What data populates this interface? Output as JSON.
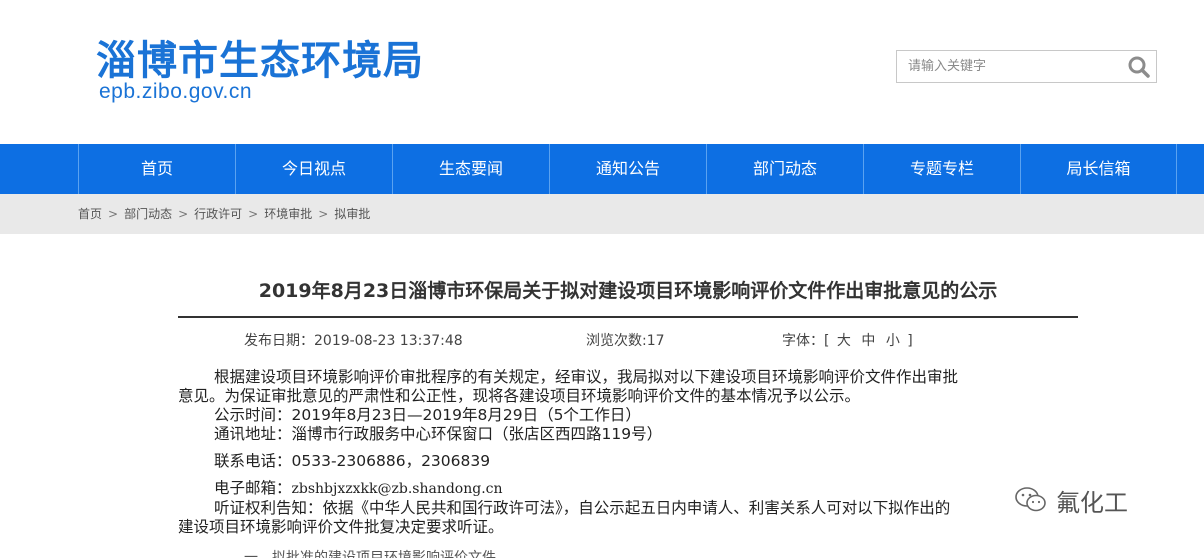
{
  "header": {
    "site_title": "淄博市生态环境局",
    "site_url": "epb.zibo.gov.cn",
    "search_placeholder": "请输入关键字"
  },
  "nav": {
    "items": [
      "首页",
      "今日视点",
      "生态要闻",
      "通知公告",
      "部门动态",
      "专题专栏",
      "局长信箱"
    ]
  },
  "breadcrumb": {
    "items": [
      "首页",
      "部门动态",
      "行政许可",
      "环境审批",
      "拟审批"
    ],
    "separator": ">"
  },
  "article": {
    "title": "2019年8月23日淄博市环保局关于拟对建设项目环境影响评价文件作出审批意见的公示",
    "meta": {
      "date_label": "发布日期：",
      "date_value": "2019-08-23 13:37:48",
      "views_label": "浏览次数:",
      "views_value": "17",
      "font_label": "字体：[",
      "font_large": "大",
      "font_medium": "中",
      "font_small": "小",
      "font_close": "]"
    },
    "intro_1": "根据建设项目环境影响评价审批程序的有关规定，经审议，我局拟对以下建设项目环境影响评价文件作出审批",
    "intro_2": "意见。为保证审批意见的严肃性和公正性，现将各建设项目环境影响评价文件的基本情况予以公示。",
    "period": "公示时间：2019年8月23日—2019年8月29日（5个工作日）",
    "address": "通讯地址：淄博市行政服务中心环保窗口（张店区西四路119号）",
    "phone": "联系电话：0533-2306886，2306839",
    "email_label": "电子邮箱：",
    "email_value": "zbshbjxzxkk@zb.shandong.cn",
    "hearing_1": "听证权利告知：依据《中华人民共和国行政许可法》，自公示起五日内申请人、利害关系人可对以下拟作出的",
    "hearing_2": "建设项目环境影响评价文件批复决定要求听证。",
    "cut_line": "一、拟批准的建设项目环境影响评价文件"
  },
  "watermark": {
    "text": "氟化工",
    "icon": "wechat-icon"
  },
  "colors": {
    "brand_blue": "#1a73d6",
    "nav_blue": "#0d6fe3",
    "crumb_bg": "#e9e9e9"
  }
}
